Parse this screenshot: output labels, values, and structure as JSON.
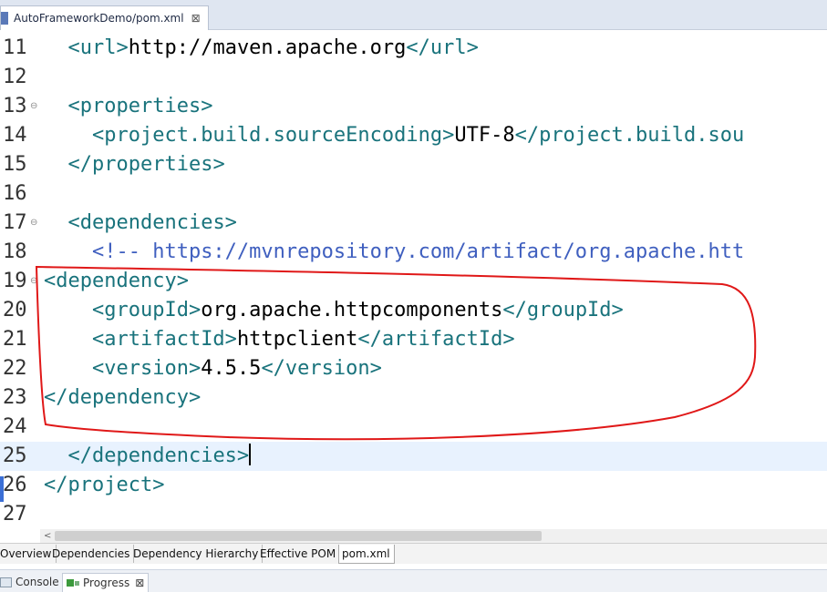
{
  "editor_tab": {
    "label": "AutoFrameworkDemo/pom.xml",
    "close": "⊠"
  },
  "lines": [
    {
      "n": "11",
      "indent": "  ",
      "open": "<url>",
      "text": "http://maven.apache.org",
      "close": "</url>"
    },
    {
      "n": "12",
      "indent": "",
      "open": "",
      "text": "",
      "close": ""
    },
    {
      "n": "13",
      "indent": "  ",
      "open": "<properties>",
      "text": "",
      "close": ""
    },
    {
      "n": "14",
      "indent": "    ",
      "open": "<project.build.sourceEncoding>",
      "text": "UTF-8",
      "close": "</project.build.sou"
    },
    {
      "n": "15",
      "indent": "  ",
      "open": "</properties>",
      "text": "",
      "close": ""
    },
    {
      "n": "16",
      "indent": "",
      "open": "",
      "text": "",
      "close": ""
    },
    {
      "n": "17",
      "indent": "  ",
      "open": "<dependencies>",
      "text": "",
      "close": ""
    },
    {
      "n": "18",
      "indent": "    ",
      "open": "",
      "text": "",
      "close": "",
      "comment": "<!-- https://mvnrepository.com/artifact/org.apache.htt"
    },
    {
      "n": "19",
      "indent": "",
      "open": "<dependency>",
      "text": "",
      "close": ""
    },
    {
      "n": "20",
      "indent": "    ",
      "open": "<groupId>",
      "text": "org.apache.httpcomponents",
      "close": "</groupId>"
    },
    {
      "n": "21",
      "indent": "    ",
      "open": "<artifactId>",
      "text": "httpclient",
      "close": "</artifactId>"
    },
    {
      "n": "22",
      "indent": "    ",
      "open": "<version>",
      "text": "4.5.5",
      "close": "</version>"
    },
    {
      "n": "23",
      "indent": "",
      "open": "</dependency>",
      "text": "",
      "close": ""
    },
    {
      "n": "24",
      "indent": "",
      "open": "",
      "text": "",
      "close": ""
    },
    {
      "n": "25",
      "indent": "  ",
      "open": "</dependencies>",
      "text": "",
      "close": ""
    },
    {
      "n": "26",
      "indent": "",
      "open": "</project>",
      "text": "",
      "close": ""
    },
    {
      "n": "27",
      "indent": "",
      "open": "",
      "text": "",
      "close": ""
    }
  ],
  "pom_tabs": [
    "Overview",
    "Dependencies",
    "Dependency Hierarchy",
    "Effective POM",
    "pom.xml"
  ],
  "bottom_views": {
    "console": "Console",
    "progress": "Progress",
    "close": "⊠"
  },
  "colors": {
    "tag": "#19737c",
    "comment": "#3f5fbf",
    "annotation": "#e01818",
    "current_line": "#e8f2fe"
  }
}
